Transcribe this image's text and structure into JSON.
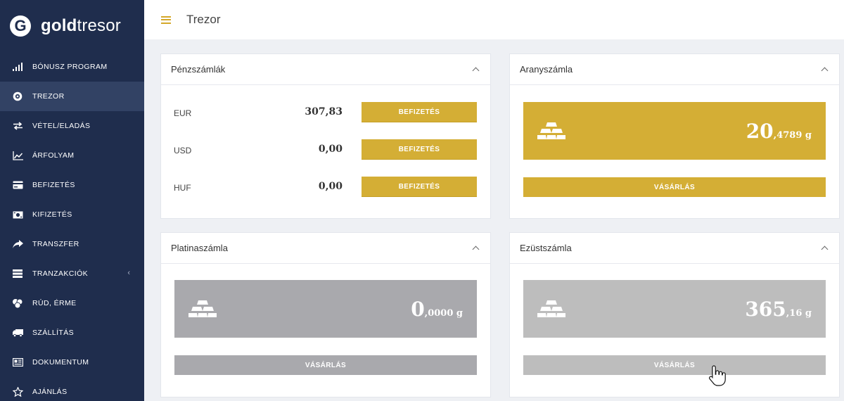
{
  "brand": {
    "bold": "gold",
    "light": "tresor",
    "mark": "G"
  },
  "topbar": {
    "title": "Trezor"
  },
  "sidebar": {
    "items": [
      {
        "label": "BÓNUSZ PROGRAM",
        "icon": "bar-chart-icon"
      },
      {
        "label": "TREZOR",
        "icon": "vault-icon",
        "active": true
      },
      {
        "label": "VÉTEL/ELADÁS",
        "icon": "exchange-icon"
      },
      {
        "label": "ÁRFOLYAM",
        "icon": "line-chart-icon"
      },
      {
        "label": "BEFIZETÉS",
        "icon": "credit-card-icon"
      },
      {
        "label": "KIFIZETÉS",
        "icon": "money-icon"
      },
      {
        "label": "TRANSZFER",
        "icon": "share-arrow-icon"
      },
      {
        "label": "TRANZAKCIÓK",
        "icon": "list-icon",
        "caret": "‹"
      },
      {
        "label": "RÚD, ÉRME",
        "icon": "coins-icon"
      },
      {
        "label": "SZÁLLÍTÁS",
        "icon": "truck-icon"
      },
      {
        "label": "DOKUMENTUM",
        "icon": "document-icon"
      },
      {
        "label": "AJÁNLÁS",
        "icon": "star-icon"
      }
    ]
  },
  "cash": {
    "title": "Pénzszámlák",
    "rows": [
      {
        "currency": "EUR",
        "amount": "307,83",
        "button": "BEFIZETÉS"
      },
      {
        "currency": "USD",
        "amount": "0,00",
        "button": "BEFIZETÉS"
      },
      {
        "currency": "HUF",
        "amount": "0,00",
        "button": "BEFIZETÉS"
      }
    ]
  },
  "gold": {
    "title": "Aranyszámla",
    "whole": "20",
    "fraction": ",4789 g",
    "button": "VÁSÁRLÁS"
  },
  "platinum": {
    "title": "Platinaszámla",
    "whole": "0",
    "fraction": ",0000 g",
    "button": "VÁSÁRLÁS"
  },
  "silver": {
    "title": "Ezüstszámla",
    "whole": "365",
    "fraction": ",16 g",
    "button": "VÁSÁRLÁS"
  },
  "colors": {
    "sidebar": "#1f2d4d",
    "sidebar_active": "#324264",
    "gold": "#d4ae35",
    "platinum": "#a9a9ad",
    "silver": "#bdbdbd"
  }
}
